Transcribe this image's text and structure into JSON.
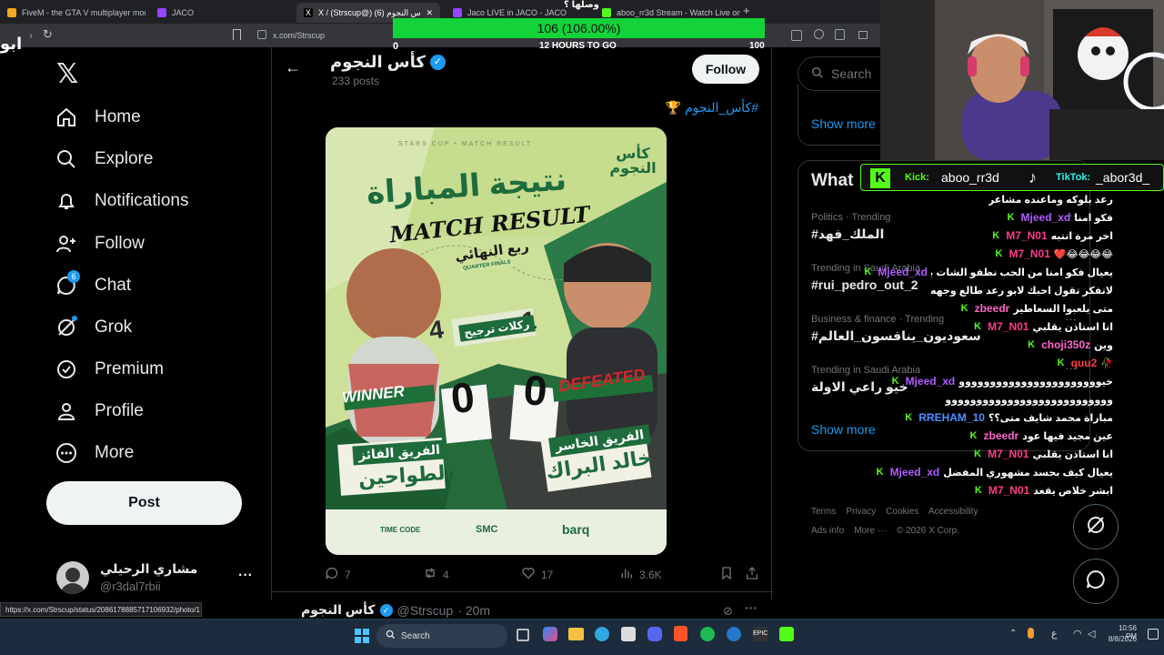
{
  "browser": {
    "tabs": [
      {
        "title": "FiveM - the GTA V multiplayer modif...",
        "color": "#f5a623"
      },
      {
        "title": "JACO",
        "color": "#9146ff"
      },
      {
        "title": "X / (Strscup@) كأس النجوم (6)",
        "color": "#ffffff"
      },
      {
        "title": "Jaco LIVE in JACO - JACO",
        "color": "#9146ff"
      },
      {
        "title": "aboo_rr3d Stream - Watch Live on Ki...",
        "color": "#53fc18"
      }
    ],
    "url": "x.com/Strscup",
    "status_url": "https://x.com/Strscup/status/2086178885717106932/photo/1"
  },
  "goal": {
    "top_label": "وصلها ؟",
    "value_text": "106 (106.00%)",
    "min": "0",
    "max": "100",
    "subtitle": "12 HOURS TO GO",
    "progress": 1.06,
    "corner_text": "ابو"
  },
  "nav": {
    "items": [
      {
        "label": "Home",
        "icon": "home-icon"
      },
      {
        "label": "Explore",
        "icon": "search-icon"
      },
      {
        "label": "Notifications",
        "icon": "bell-icon"
      },
      {
        "label": "Follow",
        "icon": "add-user-icon"
      },
      {
        "label": "Chat",
        "icon": "chat-icon",
        "badge": "6"
      },
      {
        "label": "Grok",
        "icon": "grok-icon"
      },
      {
        "label": "Premium",
        "icon": "verified-icon"
      },
      {
        "label": "Profile",
        "icon": "user-icon"
      },
      {
        "label": "More",
        "icon": "more-icon"
      }
    ],
    "post_label": "Post",
    "account_name": "مشاري الرحيلي",
    "account_handle": "@r3dal7rbii"
  },
  "profile": {
    "name": "كأس النجوم",
    "posts": "233 posts",
    "follow_label": "Follow",
    "hashtag": "#كأس_النجوم 🏆"
  },
  "poster": {
    "header": "STARS CUP • MATCH RESULT",
    "logo": "كأس النجوم",
    "title_ar": "نتيجة المباراة",
    "title_en": "MATCH RESULT",
    "round_ar": "ربع النهائي",
    "round_en": "QUARTER FINALS",
    "penalty_left": "4",
    "penalty_right": "1",
    "penalty_label": "ركلات ترجيح",
    "score_left": "0",
    "score_right": "0",
    "winner_label": "WINNER",
    "defeated_label": "DEFEATED",
    "winner_caption": "الفريق الفائز",
    "winner_team": "الطواحين",
    "loser_caption": "الفريق الخاسر",
    "loser_team": "خالد البراك",
    "sponsors": [
      "TIME CODE",
      "SMC",
      "barq"
    ]
  },
  "tweet_actions": {
    "replies": "7",
    "reposts": "4",
    "likes": "17",
    "views": "3.6K"
  },
  "next_tweet": {
    "name": "كأس النجوم",
    "handle": "@Strscup",
    "time": "· 20m"
  },
  "right": {
    "search_placeholder": "Search",
    "show_more": "Show more",
    "whats_happening": "What",
    "trends": [
      {
        "meta": "Politics · Trending",
        "title": "#الملك_فهد"
      },
      {
        "meta": "Trending in Saudi Arabia",
        "title": "#rui_pedro_out_2"
      },
      {
        "meta": "Business & finance · Trending",
        "title": "#سعوديون_ينافسون_العالم"
      },
      {
        "meta": "Trending in Saudi Arabia",
        "title": "خيو راعي الاولة"
      }
    ],
    "show_more_2": "Show more",
    "footer": [
      "Terms",
      "Privacy",
      "Cookies",
      "Accessibility",
      "Ads info",
      "More ···",
      "© 2026 X Corp."
    ]
  },
  "stream": {
    "kick_label": "Kick:",
    "kick_user": "aboo_rr3d",
    "tiktok_label": "TikTok:",
    "tiktok_user": "_abor3d_"
  },
  "chat": [
    {
      "user": "",
      "msg": "رعد بلوكه وماعنده مشاعر"
    },
    {
      "user": "Mjeed_xd",
      "msg": "فكو امنا",
      "color": "#b05cff"
    },
    {
      "user": "M7_N01",
      "msg": "اخر مرة انتبه",
      "color": "#ff3c8c"
    },
    {
      "user": "M7_N01",
      "msg": "😂😂😂😂❤️",
      "color": "#ff3c8c"
    },
    {
      "user": "Mjeed_xd",
      "msg": "يعيال فكو امنا من الحب نظفو الشات بالله قبل",
      "color": "#b05cff"
    },
    {
      "user": "",
      "msg": "لاتفكر تقول احبك لابو رعد طالع وجهه بالله"
    },
    {
      "user": "zbeedr",
      "msg": "متى يلعبوا السعاطير",
      "color": "#ff66cc"
    },
    {
      "user": "M7_N01",
      "msg": "انا استاذن يقلبي",
      "color": "#ff3c8c"
    },
    {
      "user": "choji350z",
      "msg": "وين",
      "color": "#ff66cc"
    },
    {
      "user": "quu2",
      "msg": "🥀",
      "color": "#ff3c3c"
    },
    {
      "user": "Mjeed_xd",
      "msg": "خيووووووووووووووووووووووو",
      "color": "#b05cff"
    },
    {
      "user": "",
      "msg": "ووووووووووووووووووووووووووو"
    },
    {
      "user": "RREHAM_10",
      "msg": "مباراة محمد شايف متى؟؟",
      "color": "#4f8fff"
    },
    {
      "user": "zbeedr",
      "msg": "عين مجيد فيها عود",
      "color": "#ff66cc"
    },
    {
      "user": "M7_N01",
      "msg": "انا استاذن يقلبي",
      "color": "#ff3c8c"
    },
    {
      "user": "Mjeed_xd",
      "msg": "يعيال كيف بحسد مشهوري المفضل",
      "color": "#b05cff"
    },
    {
      "user": "M7_N01",
      "msg": "ابشر خلاص يقعد",
      "color": "#ff3c8c"
    }
  ],
  "taskbar": {
    "search_label": "Search",
    "time": "10:56 PM",
    "date": "8/8/2026",
    "lang": "ع"
  },
  "colors": {
    "x_blue": "#1d9bf0",
    "goal_green": "#13d33a",
    "kick_green": "#53fc18",
    "poster_green": "#1e6b3c"
  }
}
